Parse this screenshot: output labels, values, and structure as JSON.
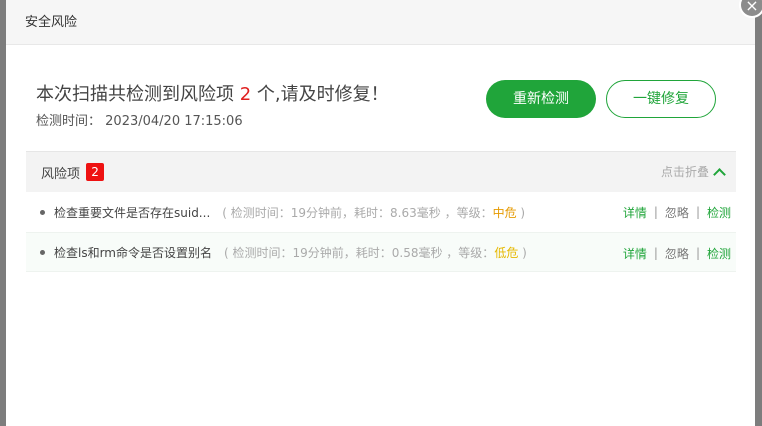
{
  "header": {
    "title": "安全风险",
    "close_symbol": "×"
  },
  "summary": {
    "prefix": "本次扫描共检测到风险项 ",
    "count": "2",
    "suffix": " 个,请及时修复！",
    "time_label": "检测时间：",
    "time_value": "2023/04/20 17:15:06"
  },
  "buttons": {
    "rescan": "重新检测",
    "fix_all": "一键修复"
  },
  "risk_panel": {
    "title": "风险项",
    "badge": "2",
    "collapse_label": "点击折叠",
    "items": [
      {
        "title": "检查重要文件是否存在suid...",
        "meta_prefix": "( 检测时间：19分钟前，耗时：8.63毫秒 ，等级：",
        "level": "中危",
        "meta_suffix": " )",
        "action_detail": "详情",
        "action_ignore": "忽略",
        "action_check": "检测",
        "sep": "|"
      },
      {
        "title": "检查ls和rm命令是否设置别名",
        "meta_prefix": "( 检测时间：19分钟前，耗时：0.58毫秒 ，等级：",
        "level": "低危",
        "meta_suffix": " )",
        "action_detail": "详情",
        "action_ignore": "忽略",
        "action_check": "检测",
        "sep": "|"
      }
    ]
  },
  "colors": {
    "accent": "#20a53a",
    "badge": "#ee1111",
    "count": "#e02020",
    "level_mid": "#e69a00",
    "level_low": "#e6b800"
  }
}
